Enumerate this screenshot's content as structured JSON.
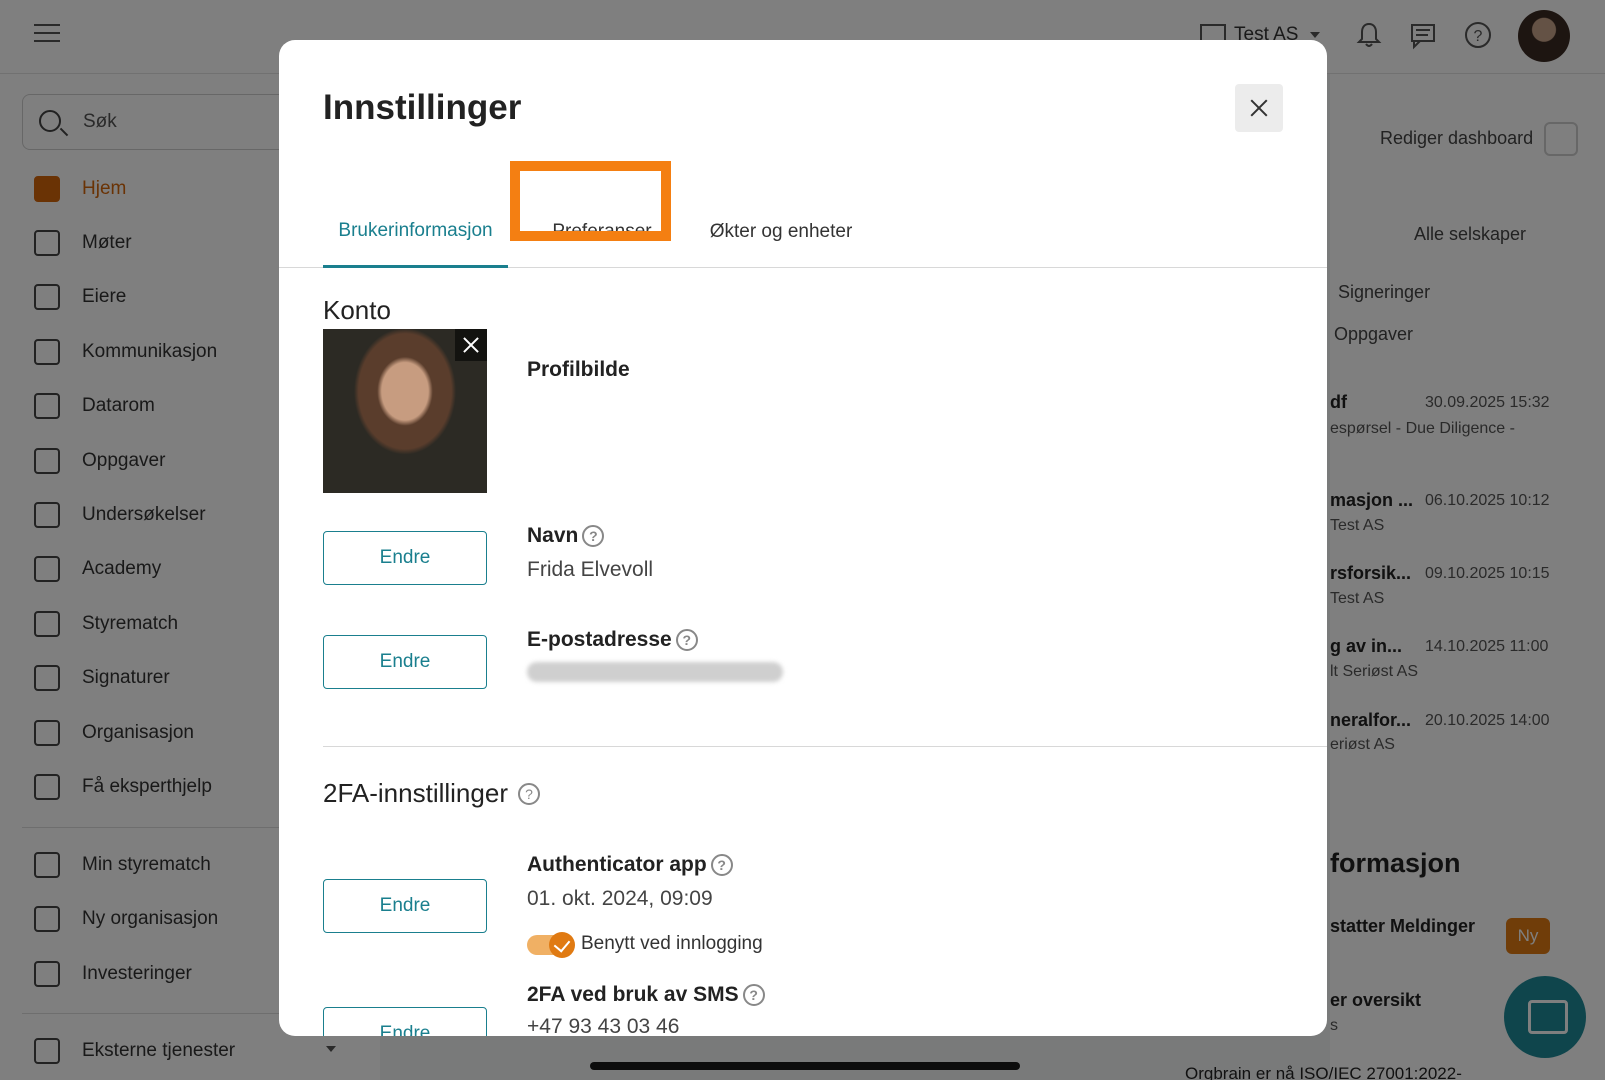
{
  "topbar": {
    "company_name": "Test AS",
    "icons": [
      "menu-icon",
      "building-icon",
      "bell-icon",
      "message-icon",
      "help-icon",
      "avatar"
    ]
  },
  "sidebar": {
    "search_placeholder": "Søk",
    "items": [
      {
        "label": "Hjem",
        "icon": "home-icon",
        "active": true
      },
      {
        "label": "Møter",
        "icon": "gavel-icon"
      },
      {
        "label": "Eiere",
        "icon": "people-icon"
      },
      {
        "label": "Kommunikasjon",
        "icon": "announcement-icon"
      },
      {
        "label": "Datarom",
        "icon": "folder-icon"
      },
      {
        "label": "Oppgaver",
        "icon": "task-icon"
      },
      {
        "label": "Undersøkelser",
        "icon": "survey-icon"
      },
      {
        "label": "Academy",
        "icon": "school-icon"
      },
      {
        "label": "Styrematch",
        "icon": "match-icon"
      },
      {
        "label": "Signaturer",
        "icon": "signature-icon"
      },
      {
        "label": "Organisasjon",
        "icon": "organization-icon"
      },
      {
        "label": "Få eksperthjelp",
        "icon": "expert-icon"
      }
    ],
    "secondary_items": [
      {
        "label": "Min styrematch",
        "icon": "match-icon"
      },
      {
        "label": "Ny organisasjon",
        "icon": "add-organization-icon"
      },
      {
        "label": "Investeringer",
        "icon": "chart-icon"
      }
    ],
    "external": {
      "label": "Eksterne tjenester",
      "icon": "external-services-icon"
    }
  },
  "background_right": {
    "edit_dashboard": "Rediger dashboard",
    "company_filter": "Alle selskaper",
    "tab_signatures": "Signeringer",
    "tab_tasks": "Oppgaver",
    "rows": [
      {
        "title": "df",
        "subtitle": "espørsel - Due Diligence -",
        "date": "30.09.2025 15:32"
      },
      {
        "title": "masjon ...",
        "subtitle": "Test AS",
        "date": "06.10.2025 10:12"
      },
      {
        "title": "rsforsik...",
        "subtitle": "Test AS",
        "date": "09.10.2025 10:15"
      },
      {
        "title": "g av in...",
        "subtitle": "lt Seriøst AS",
        "date": "14.10.2025 11:00"
      },
      {
        "title": "neralfor...",
        "subtitle": "eriøst AS",
        "date": "20.10.2025 14:00"
      }
    ],
    "info_title": "formasjon",
    "info_item_1": "statter Meldinger",
    "new_badge": "Ny",
    "info_item_2": "er oversikt",
    "info_item_2_sub": "s",
    "footer_text": "Orgbrain er nå ISO/IEC 27001:2022-"
  },
  "modal": {
    "title": "Innstillinger",
    "tabs": [
      "Brukerinformasjon",
      "Preferanser",
      "Økter og enheter"
    ],
    "active_tab": "Brukerinformasjon",
    "highlighted_tab": "Preferanser",
    "account": {
      "section_title": "Konto",
      "profile_picture_label": "Profilbilde",
      "name_label": "Navn",
      "name_value": "Frida Elvevoll",
      "email_label": "E-postadresse",
      "edit_label": "Endre"
    },
    "twofa": {
      "section_title": "2FA-innstillinger",
      "authenticator_label": "Authenticator app",
      "authenticator_date": "01. okt. 2024, 09:09",
      "use_on_login_label": "Benytt ved innlogging",
      "use_on_login_enabled": true,
      "sms_label": "2FA ved bruk av SMS",
      "sms_number": "+47 93 43 03 46",
      "edit_label": "Endre"
    }
  },
  "colors": {
    "accent_teal": "#1a7f8e",
    "accent_orange": "#e07a12",
    "highlight_orange": "#f47f12"
  }
}
